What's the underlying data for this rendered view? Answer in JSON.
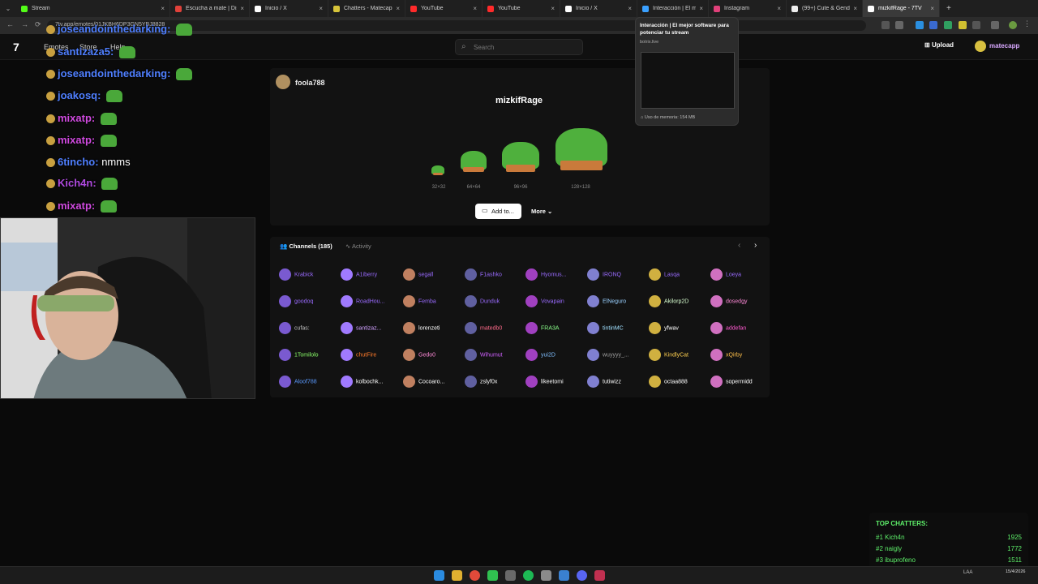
{
  "browser": {
    "tabs": [
      {
        "label": "Stream",
        "color": "#53fc18"
      },
      {
        "label": "Escucha a mate | Disfrut",
        "color": "#e0413a"
      },
      {
        "label": "Inicio / X",
        "color": "#ffffff"
      },
      {
        "label": "Chatters - Matecapp",
        "color": "#d7c43a"
      },
      {
        "label": "YouTube",
        "color": "#ff2a2a"
      },
      {
        "label": "YouTube",
        "color": "#ff2a2a"
      },
      {
        "label": "Inicio / X",
        "color": "#ffffff"
      },
      {
        "label": "Interacción | El mejor",
        "color": "#3aa0ff"
      },
      {
        "label": "Instagram",
        "color": "#e0407a"
      },
      {
        "label": "(99+) Cute & Genderle",
        "color": "#eeeeee"
      },
      {
        "label": "mizkifRage - 7TV",
        "color": "#ffffff"
      }
    ],
    "address": "7tv.app/emotes/01JKBH6DP3GN5YBJ8828",
    "new_tab": "+"
  },
  "header": {
    "logo": "7",
    "nav": [
      "Emotes",
      "Store",
      "Help"
    ],
    "search_placeholder": "Search",
    "upload_label": "Upload",
    "user_name": "matecapp"
  },
  "chat": {
    "messages": [
      {
        "user": "joseandointhedarking:",
        "color": "#4f7fff",
        "text": ""
      },
      {
        "user": "santizaza5:",
        "color": "#4f7fff",
        "text": ""
      },
      {
        "user": "joseandointhedarking:",
        "color": "#4f7fff",
        "text": ""
      },
      {
        "user": "joakosq:",
        "color": "#4f7fff",
        "text": ""
      },
      {
        "user": "mixatp:",
        "color": "#d04ae0",
        "text": ""
      },
      {
        "user": "mixatp:",
        "color": "#d04ae0",
        "text": ""
      },
      {
        "user": "6tincho:",
        "color": "#4f7fff",
        "text": "nmms"
      },
      {
        "user": "Kich4n:",
        "color": "#b04ae0",
        "text": ""
      },
      {
        "user": "mixatp:",
        "color": "#d04ae0",
        "text": ""
      }
    ]
  },
  "emote": {
    "owner": "foola788",
    "name": "mizkifRage",
    "sizes": [
      "32×32",
      "64×64",
      "96×96",
      "128×128"
    ],
    "add_label": "Add to...",
    "more_label": "More"
  },
  "channels": {
    "tab_channels": "Channels (185)",
    "tab_activity": "Activity",
    "list": [
      {
        "name": "Krabick",
        "color": "#9a6bff"
      },
      {
        "name": "A1iberry",
        "color": "#9a6bff"
      },
      {
        "name": "segall",
        "color": "#9a6bff"
      },
      {
        "name": "F1ashko",
        "color": "#9a6bff"
      },
      {
        "name": "Hyomus...",
        "color": "#9a6bff"
      },
      {
        "name": "IRONQ",
        "color": "#9a6bff"
      },
      {
        "name": "Lasqa",
        "color": "#9a6bff"
      },
      {
        "name": "Loeya",
        "color": "#9a6bff"
      },
      {
        "name": "goodoq",
        "color": "#9a6bff"
      },
      {
        "name": "RoadHou...",
        "color": "#9a6bff"
      },
      {
        "name": "Femba",
        "color": "#9a6bff"
      },
      {
        "name": "Dunduk",
        "color": "#9a6bff"
      },
      {
        "name": "Vovapain",
        "color": "#9a6bff"
      },
      {
        "name": "ElNeguro",
        "color": "#9ad0ff"
      },
      {
        "name": "Akilorp2D",
        "color": "#d8ffd0"
      },
      {
        "name": "dosedgy",
        "color": "#ff8ad8"
      },
      {
        "name": "cufas:",
        "color": "#c0c0c0"
      },
      {
        "name": "santizaz...",
        "color": "#d0a0ff"
      },
      {
        "name": "lorenzeti",
        "color": "#ffffff"
      },
      {
        "name": "matedb0",
        "color": "#ff6a8a"
      },
      {
        "name": "FRA3A",
        "color": "#8aff8a"
      },
      {
        "name": "tintinMC",
        "color": "#a0e0ff"
      },
      {
        "name": "yfwav",
        "color": "#ffffff"
      },
      {
        "name": "addefan",
        "color": "#ff5ad0"
      },
      {
        "name": "1Tomilolo",
        "color": "#8aff6a"
      },
      {
        "name": "chutFire",
        "color": "#ff7a2a"
      },
      {
        "name": "Gedo0",
        "color": "#ff8ad8"
      },
      {
        "name": "Wihumut",
        "color": "#d060ff"
      },
      {
        "name": "yui2D",
        "color": "#80c0ff"
      },
      {
        "name": "wuyyyy_...",
        "color": "#a0a0a0"
      },
      {
        "name": "KindlyCat",
        "color": "#ffd050"
      },
      {
        "name": "xQirby",
        "color": "#ffc04a"
      },
      {
        "name": "Aloof788",
        "color": "#5a9aff"
      },
      {
        "name": "kolbochk...",
        "color": "#ffffff"
      },
      {
        "name": "Cocoaro...",
        "color": "#ffffff"
      },
      {
        "name": "zslyf0x",
        "color": "#ffffff"
      },
      {
        "name": "likeetomi",
        "color": "#ffffff"
      },
      {
        "name": "tutiwizz",
        "color": "#ffffff"
      },
      {
        "name": "octaa888",
        "color": "#ffffff"
      },
      {
        "name": "sopermidd",
        "color": "#ffffff"
      }
    ]
  },
  "preview": {
    "title": "Interacción | El mejor software para potenciar tu stream",
    "domain": "botrix.live",
    "memory": "Uso de memoria: 154 MB"
  },
  "top_chatters": {
    "title": "TOP CHATTERS:",
    "rows": [
      {
        "name": "#1 Kich4n",
        "count": "1925"
      },
      {
        "name": "#2 naigly",
        "count": "1772"
      },
      {
        "name": "#3 ibuprofeno",
        "count": "1511"
      }
    ]
  },
  "taskbar": {
    "lang": "LAA",
    "time": "",
    "date": "15/4/2026"
  }
}
